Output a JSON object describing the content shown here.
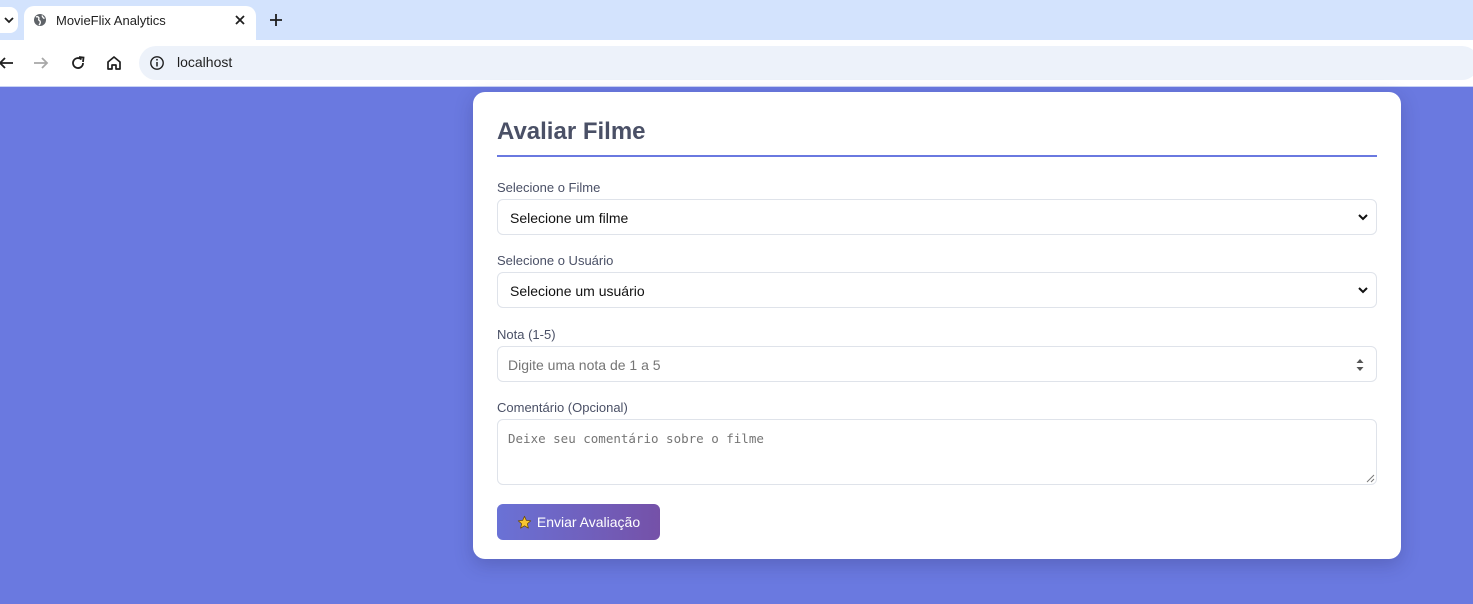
{
  "browser": {
    "tab_title": "MovieFlix Analytics",
    "url": "localhost"
  },
  "form": {
    "title": "Avaliar Filme",
    "movie": {
      "label": "Selecione o Filme",
      "selected": "Selecione um filme"
    },
    "user": {
      "label": "Selecione o Usuário",
      "selected": "Selecione um usuário"
    },
    "rating": {
      "label": "Nota (1-5)",
      "placeholder": "Digite uma nota de 1 a 5"
    },
    "comment": {
      "label": "Comentário (Opcional)",
      "placeholder": "Deixe seu comentário sobre o filme"
    },
    "submit_label": "Enviar Avaliação",
    "submit_icon": "star-icon"
  },
  "colors": {
    "page_background": "#6a79e0",
    "accent": "#6a79e0",
    "button_gradient_start": "#6a72d6",
    "button_gradient_end": "#7551a8"
  }
}
